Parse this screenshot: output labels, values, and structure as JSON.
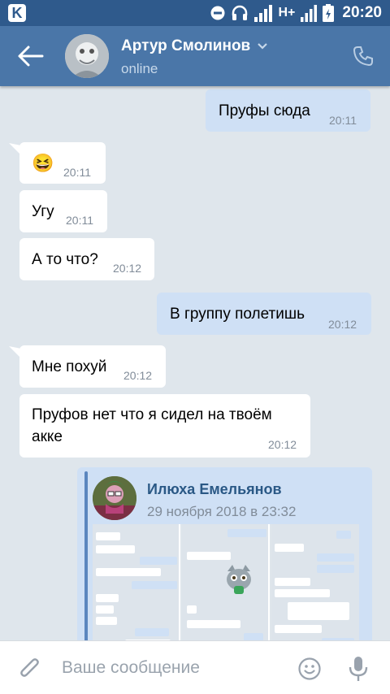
{
  "status_bar": {
    "time": "20:20",
    "network": "H+",
    "app_icon": "K",
    "icons": [
      "dnd-icon",
      "headphones-icon",
      "signal-icon",
      "battery-icon"
    ]
  },
  "header": {
    "name": "Артур Смолинов",
    "status": "online",
    "icons": [
      "back-arrow-icon",
      "chevron-down-icon",
      "phone-icon"
    ]
  },
  "colors": {
    "header": "#4a76a8",
    "status_bar": "#2f5a8c",
    "out_bubble": "#cfe0f5",
    "in_bubble": "#ffffff",
    "background": "#dfe6ec",
    "link": "#2a5885"
  },
  "messages": [
    {
      "direction": "out",
      "text": "Пруфы сюда",
      "time": "20:11"
    },
    {
      "direction": "in",
      "text": "😆",
      "time": "20:11"
    },
    {
      "direction": "in",
      "text": "Угу",
      "time": "20:11"
    },
    {
      "direction": "in",
      "text": "А то что?",
      "time": "20:12"
    },
    {
      "direction": "out",
      "text": "В группу полетишь",
      "time": "20:12"
    },
    {
      "direction": "in",
      "text": "Мне похуй",
      "time": "20:12"
    },
    {
      "direction": "in",
      "text_line1": "Пруфов нет что я сидел на твоём",
      "text_line2": "акке",
      "time": "20:12"
    }
  ],
  "forwarded": {
    "author": "Илюха Емельянов",
    "date": "29 ноября 2018 в 23:32"
  },
  "input": {
    "placeholder": "Ваше сообщение",
    "value": ""
  }
}
